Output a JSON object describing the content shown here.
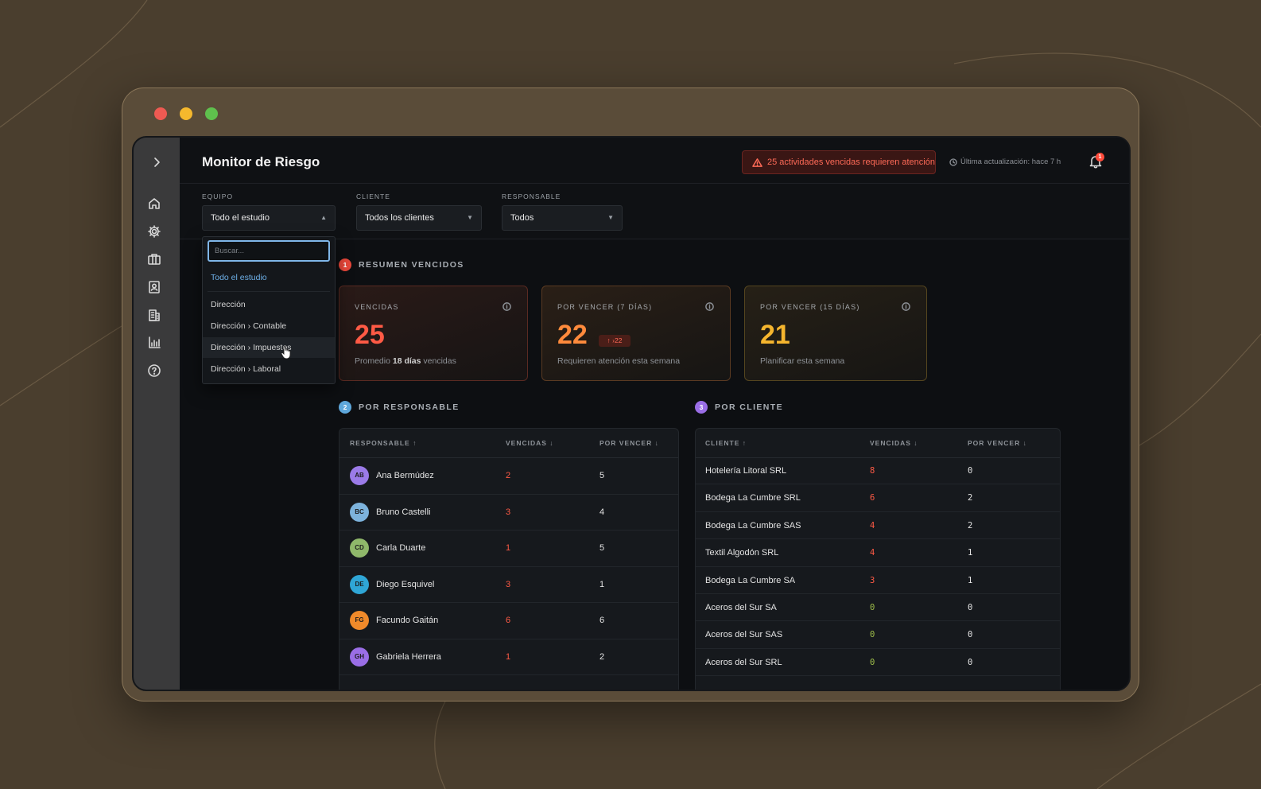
{
  "header": {
    "title": "Monitor de Riesgo",
    "alert_text": "25 actividades vencidas requieren atención",
    "updated_text": "Última actualización: hace 7 h",
    "notification_count": "1"
  },
  "filters": {
    "equipo": {
      "label": "EQUIPO",
      "value": "Todo el estudio"
    },
    "cliente": {
      "label": "CLIENTE",
      "value": "Todos los clientes"
    },
    "responsable": {
      "label": "RESPONSABLE",
      "value": "Todos"
    }
  },
  "dropdown": {
    "search_placeholder": "Buscar...",
    "selected": "Todo el estudio",
    "options": [
      "Dirección",
      "Dirección › Contable",
      "Dirección › Impuestos",
      "Dirección › Laboral"
    ]
  },
  "sections": {
    "resumen": {
      "num": "1",
      "title": "RESUMEN VENCIDOS"
    },
    "responsable": {
      "num": "2",
      "title": "POR RESPONSABLE"
    },
    "cliente": {
      "num": "3",
      "title": "POR CLIENTE"
    }
  },
  "cards": [
    {
      "title": "VENCIDAS",
      "value": "25",
      "sub_prefix": "Promedio ",
      "sub_bold": "18 días",
      "sub_suffix": " vencidas",
      "color": "#ff5a45"
    },
    {
      "title": "POR VENCER (7 DÍAS)",
      "value": "22",
      "trend": "↑ ›22",
      "sub": "Requieren atención esta semana",
      "color": "#ff8a3c"
    },
    {
      "title": "POR VENCER (15 DÍAS)",
      "value": "21",
      "sub": "Planificar esta semana",
      "color": "#f5b52e"
    }
  ],
  "responsable_table": {
    "headers": [
      "RESPONSABLE ↑",
      "VENCIDAS ↓",
      "POR VENCER ↓"
    ],
    "rows": [
      {
        "initials": "AB",
        "name": "Ana Bermúdez",
        "vencidas": "2",
        "por_vencer": "5",
        "avatar_color": "#9b7be8"
      },
      {
        "initials": "BC",
        "name": "Bruno Castelli",
        "vencidas": "3",
        "por_vencer": "4",
        "avatar_color": "#7db3dc"
      },
      {
        "initials": "CD",
        "name": "Carla Duarte",
        "vencidas": "1",
        "por_vencer": "5",
        "avatar_color": "#8fb86a"
      },
      {
        "initials": "DE",
        "name": "Diego Esquivel",
        "vencidas": "3",
        "por_vencer": "1",
        "avatar_color": "#2fa6d6"
      },
      {
        "initials": "FG",
        "name": "Facundo Gaitán",
        "vencidas": "6",
        "por_vencer": "6",
        "avatar_color": "#f08a2a"
      },
      {
        "initials": "GH",
        "name": "Gabriela Herrera",
        "vencidas": "1",
        "por_vencer": "2",
        "avatar_color": "#9a6ee6"
      }
    ]
  },
  "cliente_table": {
    "headers": [
      "CLIENTE ↑",
      "VENCIDAS ↓",
      "POR VENCER ↓"
    ],
    "rows": [
      {
        "name": "Hotelería Litoral SRL",
        "vencidas": "8",
        "por_vencer": "0"
      },
      {
        "name": "Bodega La Cumbre SRL",
        "vencidas": "6",
        "por_vencer": "2"
      },
      {
        "name": "Bodega La Cumbre SAS",
        "vencidas": "4",
        "por_vencer": "2"
      },
      {
        "name": "Textil Algodón SRL",
        "vencidas": "4",
        "por_vencer": "1"
      },
      {
        "name": "Bodega La Cumbre SA",
        "vencidas": "3",
        "por_vencer": "1"
      },
      {
        "name": "Aceros del Sur SA",
        "vencidas": "0",
        "por_vencer": "0"
      },
      {
        "name": "Aceros del Sur SAS",
        "vencidas": "0",
        "por_vencer": "0"
      },
      {
        "name": "Aceros del Sur SRL",
        "vencidas": "0",
        "por_vencer": "0"
      }
    ]
  },
  "colors": {
    "danger": "#ff5a45",
    "ok": "#9fbf4a",
    "accent": "#6eb0e8"
  }
}
